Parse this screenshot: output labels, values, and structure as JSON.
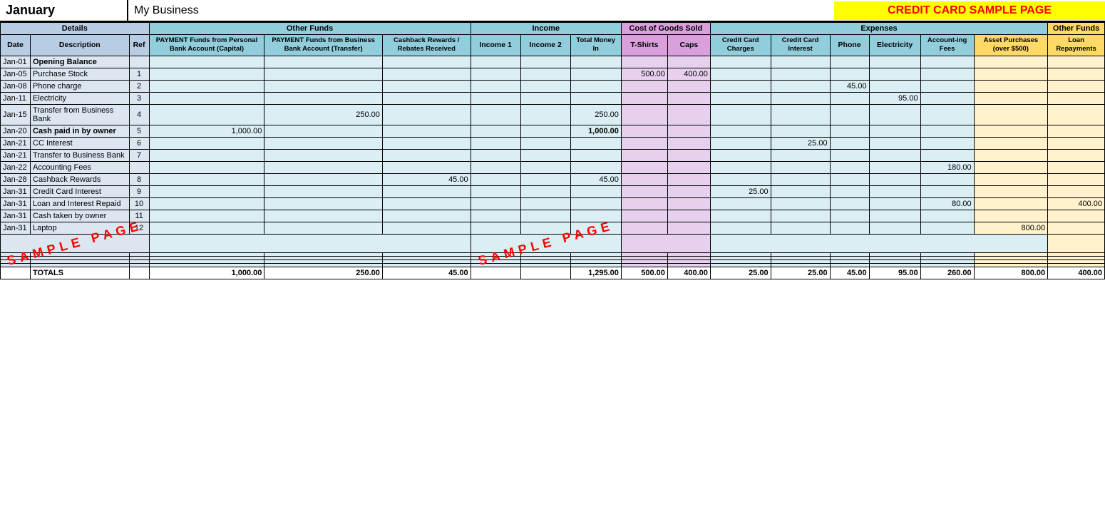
{
  "topBar": {
    "month": "January",
    "business": "My Business",
    "creditTitle": "CREDIT CARD SAMPLE PAGE"
  },
  "groups": {
    "details": "Details",
    "otherFunds": "Other Funds",
    "income": "Income",
    "cogs": "Cost of Goods Sold",
    "expenses": "Expenses",
    "otherFunds2": "Other Funds"
  },
  "columns": {
    "date": "Date",
    "description": "Description",
    "ref": "Ref",
    "paymentPersonal": "PAYMENT Funds from Personal Bank Account (Capital)",
    "paymentBusiness": "PAYMENT Funds from Business Bank Account (Transfer)",
    "cashback": "Cashback Rewards / Rebates Received",
    "income1": "Income 1",
    "income2": "Income 2",
    "totalMoneyIn": "Total Money In",
    "tshirts": "T-Shirts",
    "caps": "Caps",
    "ccCharges": "Credit Card Charges",
    "ccInterest": "Credit Card Interest",
    "phone": "Phone",
    "electricity": "Electricity",
    "accountingFees": "Account-ing Fees",
    "assetPurchases": "Asset Purchases (over $500)",
    "loanRepayments": "Loan Repayments"
  },
  "rows": [
    {
      "date": "Jan-01",
      "desc": "Opening Balance",
      "ref": "",
      "bold": true
    },
    {
      "date": "Jan-05",
      "desc": "Purchase Stock",
      "ref": "1",
      "tshirts": "500.00",
      "caps": "400.00"
    },
    {
      "date": "Jan-08",
      "desc": "Phone charge",
      "ref": "2",
      "phone": "45.00"
    },
    {
      "date": "Jan-11",
      "desc": "Electricity",
      "ref": "3",
      "electricity": "95.00"
    },
    {
      "date": "Jan-15",
      "desc": "Transfer from Business Bank",
      "ref": "4",
      "paymentBusiness": "250.00",
      "totalMoneyIn": "250.00"
    },
    {
      "date": "Jan-20",
      "desc": "Cash paid in by owner",
      "ref": "5",
      "paymentPersonal": "1,000.00",
      "totalMoneyIn": "1,000.00",
      "bold": true
    },
    {
      "date": "Jan-21",
      "desc": "CC Interest",
      "ref": "6",
      "ccInterest": "25.00"
    },
    {
      "date": "Jan-21",
      "desc": "Transfer to Business Bank",
      "ref": "7"
    },
    {
      "date": "Jan-22",
      "desc": "Accounting Fees",
      "ref": "",
      "accountingFees": "180.00"
    },
    {
      "date": "Jan-28",
      "desc": "Cashback Rewards",
      "ref": "8",
      "cashback": "45.00",
      "totalMoneyIn": "45.00"
    },
    {
      "date": "Jan-31",
      "desc": "Credit Card Interest",
      "ref": "9",
      "ccCharges": "25.00"
    },
    {
      "date": "Jan-31",
      "desc": "Loan and Interest Repaid",
      "ref": "10",
      "accountingFees": "80.00",
      "loanRepayments": "400.00"
    },
    {
      "date": "Jan-31",
      "desc": "Cash taken by owner",
      "ref": "11"
    },
    {
      "date": "Jan-31",
      "desc": "Laptop",
      "ref": "12",
      "assetPurchases": "800.00"
    },
    {
      "date": "",
      "desc": "",
      "ref": "",
      "sample": true
    },
    {
      "date": "",
      "desc": "",
      "ref": ""
    },
    {
      "date": "",
      "desc": "",
      "ref": ""
    },
    {
      "date": "",
      "desc": "",
      "ref": ""
    },
    {
      "date": "",
      "desc": "",
      "ref": ""
    }
  ],
  "totals": {
    "label": "TOTALS",
    "paymentPersonal": "1,000.00",
    "paymentBusiness": "250.00",
    "cashback": "45.00",
    "income1": "",
    "income2": "",
    "totalMoneyIn": "1,295.00",
    "tshirts": "500.00",
    "caps": "400.00",
    "ccCharges": "25.00",
    "ccInterest": "25.00",
    "phone": "45.00",
    "electricity": "95.00",
    "accountingFees": "260.00",
    "assetPurchases": "800.00",
    "loanRepayments": "400.00"
  },
  "sampleText": "SAMPLE PAGE"
}
